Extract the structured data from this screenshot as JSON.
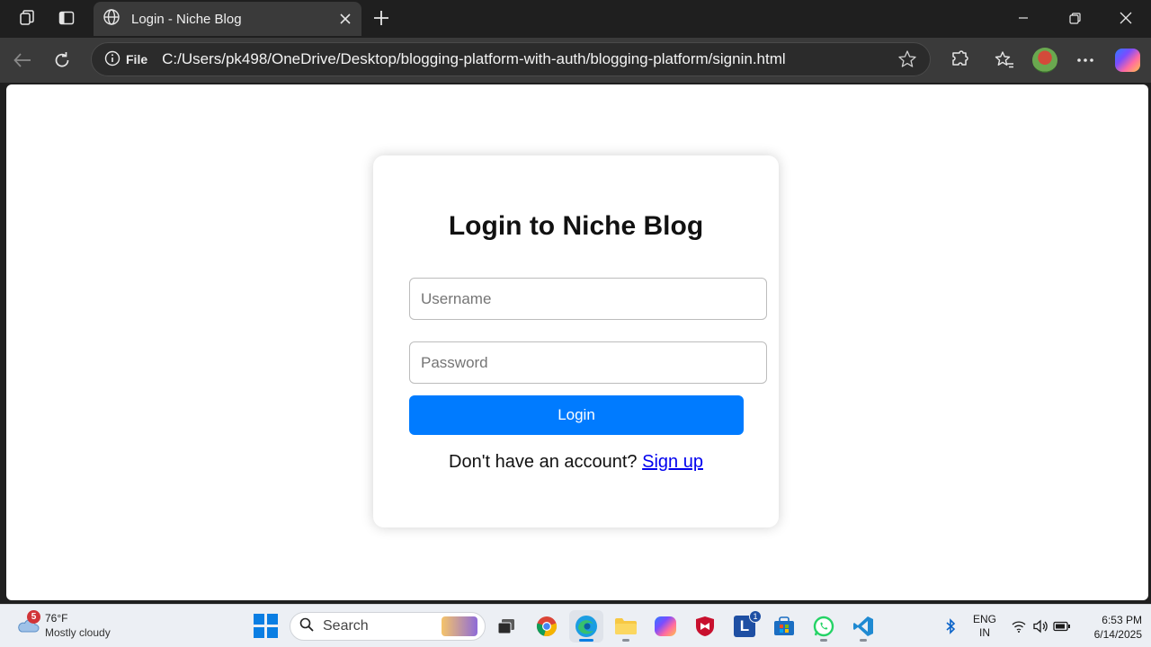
{
  "browser": {
    "tab": {
      "title": "Login - Niche Blog"
    },
    "address_bar": {
      "security_label": "File",
      "url": "C:/Users/pk498/OneDrive/Desktop/blogging-platform-with-auth/blogging-platform/signin.html"
    },
    "icons": [
      "workspaces-icon",
      "tab-actions-icon",
      "globe-icon",
      "close-tab-icon",
      "new-tab-icon",
      "minimize-icon",
      "restore-icon",
      "close-window-icon",
      "back-icon",
      "refresh-icon",
      "info-icon",
      "favorite-star-icon",
      "extensions-icon",
      "favorites-icon",
      "profile-avatar",
      "more-icon",
      "copilot-icon"
    ]
  },
  "page": {
    "heading": "Login to Niche Blog",
    "username_placeholder": "Username",
    "password_placeholder": "Password",
    "login_button": "Login",
    "signup_prompt": "Don't have an account?",
    "signup_link": "Sign up",
    "colors": {
      "primary_button": "#007bff",
      "link": "#0000ee"
    }
  },
  "taskbar": {
    "weather": {
      "badge": "5",
      "temperature": "76°F",
      "condition": "Mostly cloudy"
    },
    "search_label": "Search",
    "apps": [
      "start",
      "search",
      "task-view",
      "chrome",
      "edge",
      "file-explorer",
      "copilot",
      "mcafee",
      "word-l",
      "store",
      "whatsapp",
      "vscode"
    ],
    "notification_badge": "1",
    "language": {
      "line1": "ENG",
      "line2": "IN"
    },
    "clock": {
      "time": "6:53 PM",
      "date": "6/14/2025"
    }
  }
}
